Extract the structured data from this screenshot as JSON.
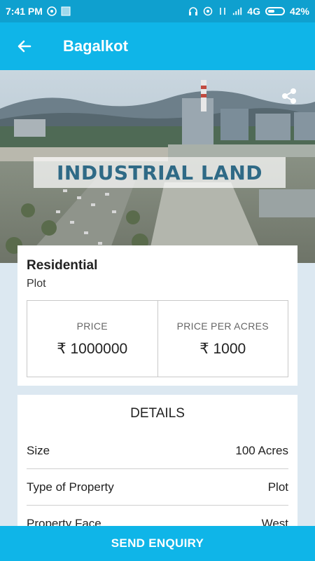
{
  "status_bar": {
    "time": "7:41 PM",
    "network": "4G",
    "battery": "42%"
  },
  "app_bar": {
    "title": "Bagalkot"
  },
  "hero": {
    "banner_text": "INDUSTRIAL LAND"
  },
  "summary": {
    "type": "Residential",
    "subtype": "Plot",
    "price_label": "PRICE",
    "price_value": "₹ 1000000",
    "price_per_label": "PRICE PER ACRES",
    "price_per_value": "₹ 1000"
  },
  "details": {
    "heading": "DETAILS",
    "rows": [
      {
        "label": "Size",
        "value": "100 Acres"
      },
      {
        "label": "Type of Property",
        "value": "Plot"
      },
      {
        "label": "Property Face",
        "value": "West"
      }
    ]
  },
  "actions": {
    "enquiry_label": "SEND ENQUIRY"
  },
  "colors": {
    "status_bar": "#0fa0cf",
    "primary": "#0fb5e8",
    "background": "#dce8f1"
  }
}
